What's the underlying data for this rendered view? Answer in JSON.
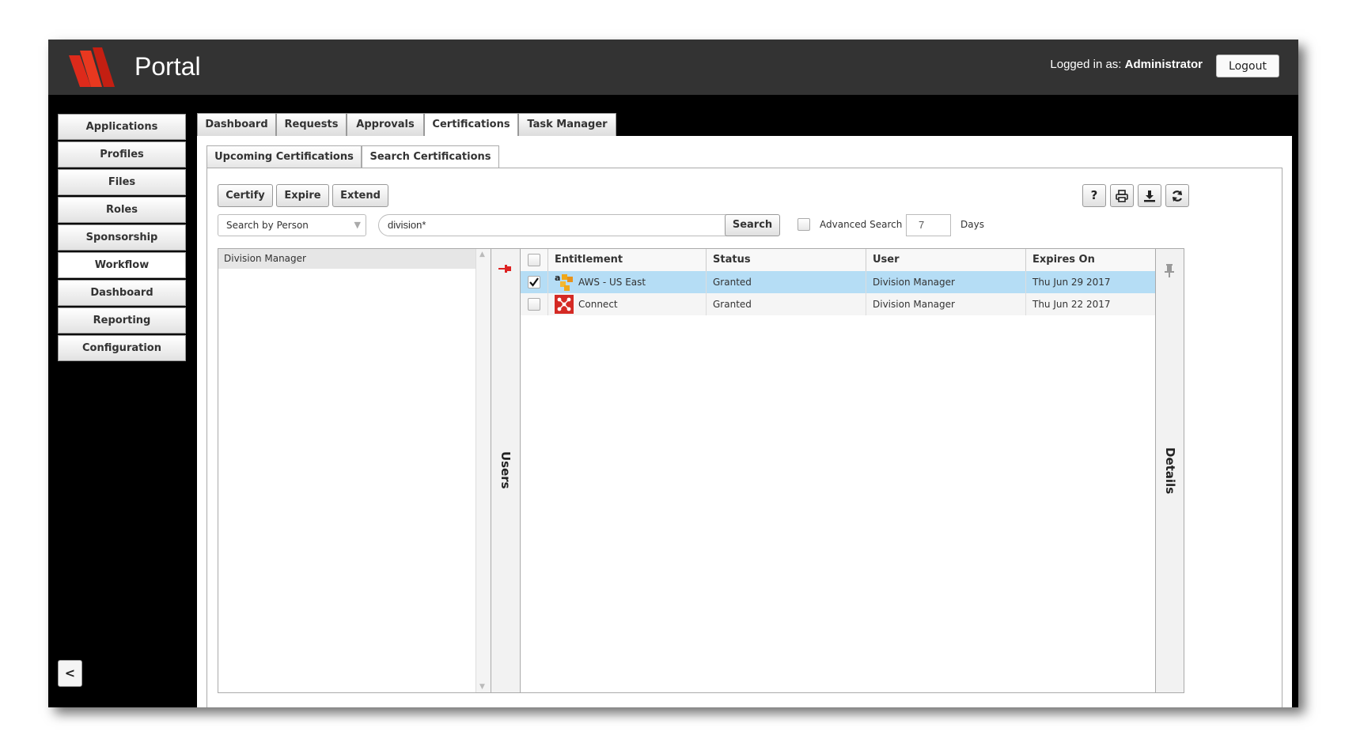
{
  "header": {
    "app_title": "Portal",
    "logged_in_prefix": "Logged in as: ",
    "logged_in_user": "Administrator",
    "logout_label": "Logout",
    "logo_color": "#dd2a1b"
  },
  "sidebar": {
    "items": [
      {
        "label": "Applications"
      },
      {
        "label": "Profiles"
      },
      {
        "label": "Files"
      },
      {
        "label": "Roles"
      },
      {
        "label": "Sponsorship"
      },
      {
        "label": "Workflow"
      },
      {
        "label": "Dashboard"
      },
      {
        "label": "Reporting"
      },
      {
        "label": "Configuration"
      }
    ],
    "active_item": "Workflow",
    "collapse_label": "<"
  },
  "main_tabs": {
    "items": [
      {
        "label": "Dashboard"
      },
      {
        "label": "Requests"
      },
      {
        "label": "Approvals"
      },
      {
        "label": "Certifications"
      },
      {
        "label": "Task Manager"
      }
    ],
    "active": "Certifications"
  },
  "sub_tabs": {
    "items": [
      {
        "label": "Upcoming Certifications"
      },
      {
        "label": "Search Certifications"
      }
    ],
    "active": "Search Certifications"
  },
  "toolbar": {
    "certify_label": "Certify",
    "expire_label": "Expire",
    "extend_label": "Extend",
    "icons": [
      "help-icon",
      "print-icon",
      "download-icon",
      "refresh-icon"
    ],
    "help_glyph": "?"
  },
  "search": {
    "mode": "Search by Person",
    "query": "division*",
    "search_label": "Search",
    "advanced_label": "Advanced Search",
    "advanced_checked": false,
    "days_value": "7",
    "days_label": "Days"
  },
  "users_panel": {
    "title": "Users",
    "items": [
      "Division Manager"
    ]
  },
  "grid": {
    "columns": [
      "Entitlement",
      "Status",
      "User",
      "Expires On"
    ],
    "rows": [
      {
        "checked": true,
        "icon": "aws-icon",
        "entitlement": "AWS - US East",
        "status": "Granted",
        "user": "Division Manager",
        "expires": "Thu Jun 29 2017"
      },
      {
        "checked": false,
        "icon": "connect-icon",
        "entitlement": "Connect",
        "status": "Granted",
        "user": "Division Manager",
        "expires": "Thu Jun 22 2017"
      }
    ]
  },
  "details_panel": {
    "title": "Details"
  },
  "colors": {
    "selected_row": "#b5ddf5",
    "granted": "#33aa33",
    "user_link": "#2222cc",
    "header_bg": "#333333"
  }
}
